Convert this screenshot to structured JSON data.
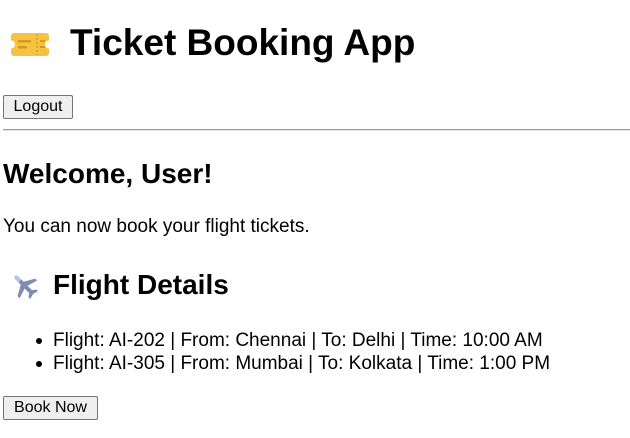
{
  "app": {
    "icon": "ticket-icon",
    "title": "Ticket Booking App"
  },
  "header": {
    "logout_label": "Logout"
  },
  "welcome": {
    "heading": "Welcome, User!",
    "message": "You can now book your flight tickets."
  },
  "flights": {
    "icon": "airplane-icon",
    "heading": "Flight Details",
    "items": [
      {
        "text": "Flight: AI-202 | From: Chennai | To: Delhi | Time: 10:00 AM"
      },
      {
        "text": "Flight: AI-305 | From: Mumbai | To: Kolkata | Time: 1:00 PM"
      }
    ],
    "book_label": "Book Now"
  },
  "colors": {
    "ticket_icon": "#f5c242",
    "airplane_icon": "#7d8cb0"
  }
}
